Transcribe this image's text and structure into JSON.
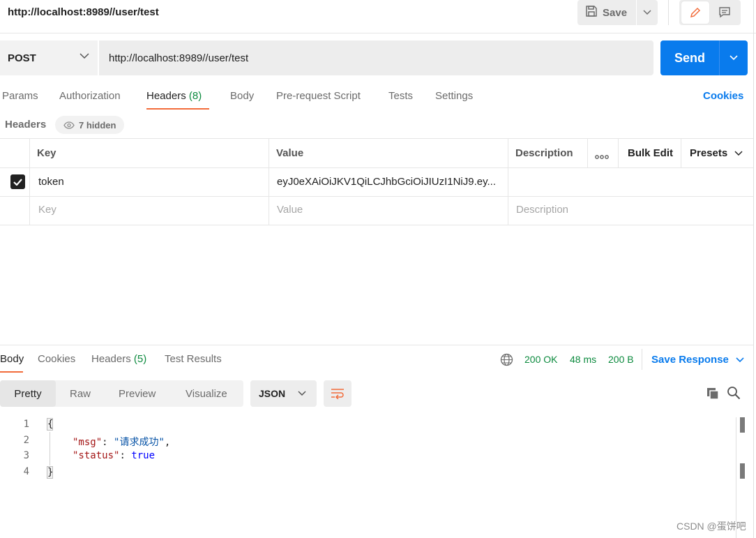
{
  "request": {
    "title": "http://localhost:8989//user/test",
    "save_label": "Save",
    "method": "POST",
    "url": "http://localhost:8989//user/test",
    "send_label": "Send"
  },
  "request_tabs": {
    "params": "Params",
    "authorization": "Authorization",
    "headers": "Headers",
    "headers_count": "(8)",
    "body": "Body",
    "prerequest": "Pre-request Script",
    "tests": "Tests",
    "settings": "Settings",
    "cookies": "Cookies"
  },
  "headers_section": {
    "label": "Headers",
    "hidden": "7 hidden"
  },
  "headers_table": {
    "columns": {
      "key": "Key",
      "value": "Value",
      "description": "Description",
      "bulk_edit": "Bulk Edit",
      "presets": "Presets"
    },
    "rows": [
      {
        "checked": true,
        "key": "token",
        "value": "eyJ0eXAiOiJKV1QiLCJhbGciOiJIUzI1NiJ9.ey..."
      }
    ],
    "placeholders": {
      "key": "Key",
      "value": "Value",
      "description": "Description"
    }
  },
  "response_tabs": {
    "body": "Body",
    "cookies": "Cookies",
    "headers": "Headers",
    "headers_count": "(5)",
    "test_results": "Test Results"
  },
  "response_status": {
    "status": "200 OK",
    "time": "48 ms",
    "size": "200 B",
    "save_response": "Save Response"
  },
  "view_options": {
    "pretty": "Pretty",
    "raw": "Raw",
    "preview": "Preview",
    "visualize": "Visualize",
    "format": "JSON"
  },
  "code": {
    "line_numbers": [
      "1",
      "2",
      "3",
      "4"
    ],
    "open_brace": "{",
    "close_brace": "}",
    "msg_key": "\"msg\"",
    "msg_value": "\"请求成功\"",
    "status_key": "\"status\"",
    "status_value": "true"
  },
  "watermark": "CSDN @蛋饼吧",
  "colors": {
    "accent_blue": "#097bed",
    "tab_underline": "#f26b3a",
    "status_green": "#0c8a3e"
  }
}
